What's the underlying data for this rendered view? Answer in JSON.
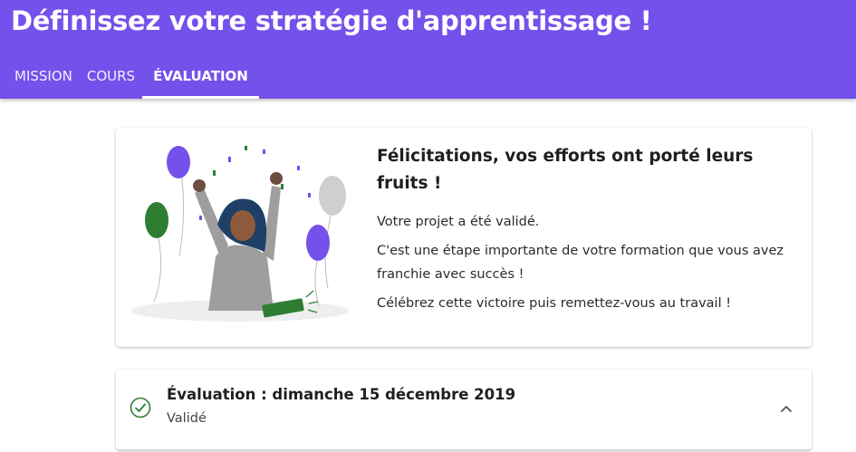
{
  "header": {
    "title": "Définissez votre stratégie d'apprentissage !",
    "tabs": [
      {
        "label": "MISSION",
        "active": false
      },
      {
        "label": "COURS",
        "active": false
      },
      {
        "label": "ÉVALUATION",
        "active": true
      }
    ]
  },
  "congrats": {
    "title": "Félicitations, vos efforts ont porté leurs fruits !",
    "paragraphs": [
      "Votre projet a été validé.",
      "C'est une étape importante de votre formation que vous avez franchie avec succès !",
      "Célébrez cette victoire puis remettez-vous au travail !"
    ]
  },
  "evaluation": {
    "title": "Évaluation : dimanche 15 décembre 2019",
    "status": "Validé",
    "icon": "check-circle-icon",
    "expand_icon": "chevron-up-icon"
  },
  "colors": {
    "brand": "#7451eb",
    "success": "#2e7d32"
  }
}
